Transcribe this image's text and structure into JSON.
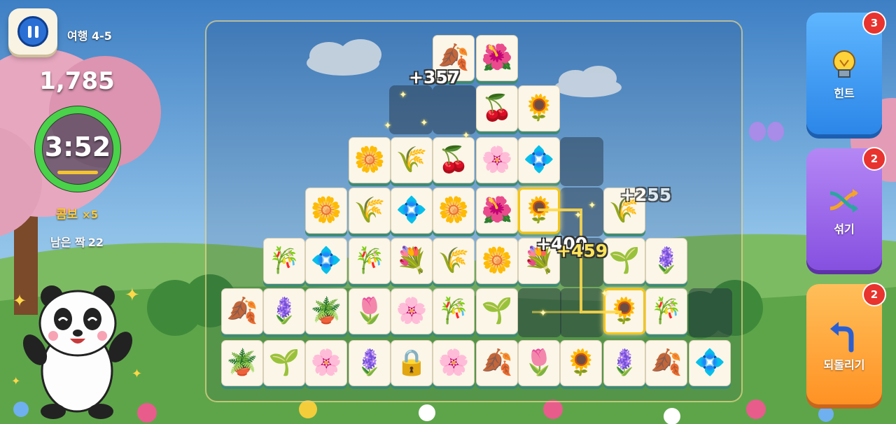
{
  "hud": {
    "level": "여행 4-5",
    "score": "1,785",
    "timer": "3:52",
    "timer_progress": 1.0,
    "combo_label": "콤보",
    "combo_value": "×5",
    "pairs_label": "남은 짝",
    "pairs_value": "22"
  },
  "side_buttons": {
    "hint": {
      "label": "힌트",
      "count": "3"
    },
    "shuffle": {
      "label": "섞기",
      "count": "2"
    },
    "undo": {
      "label": "되돌리기",
      "count": "2"
    }
  },
  "float_scores": [
    "+357",
    "+255",
    "+400",
    "+459"
  ],
  "tile_names": [
    "ginkgo",
    "bird-of-paradise",
    "holly",
    "sunflower",
    "lily",
    "dandelion",
    "hibiscus",
    "morning-glory",
    "wheat",
    "bamboo",
    "bouquet",
    "bellflower",
    "sprout",
    "succulent",
    "iris",
    "padlock"
  ],
  "colors": {
    "accent": "#f5c518",
    "hint": "#3a96f0",
    "shuffle": "#9b68ea",
    "undo": "#ff9f38",
    "badge": "#e8332e"
  }
}
